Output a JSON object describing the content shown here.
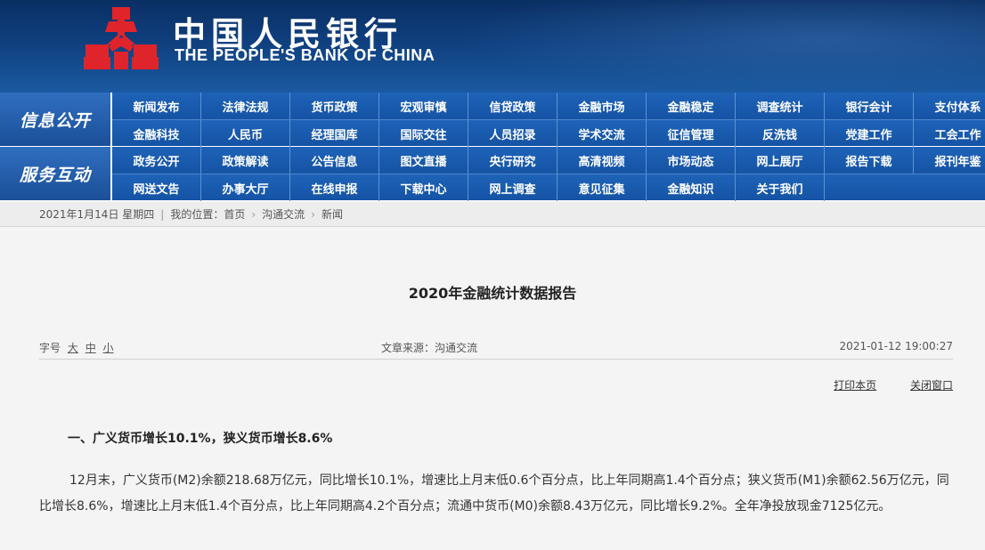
{
  "header": {
    "bank_name_cn": "中国人民银行",
    "bank_name_en": "THE PEOPLE'S BANK OF CHINA",
    "logo_icon": "pboc-logo-icon",
    "logo_color": "#e0242b"
  },
  "nav": {
    "section1_label": "信息公开",
    "section2_label": "服务互动",
    "section1_row1": [
      "新闻发布",
      "法律法规",
      "货币政策",
      "宏观审慎",
      "信贷政策",
      "金融市场",
      "金融稳定",
      "调查统计",
      "银行会计",
      "支付体系"
    ],
    "section1_row2": [
      "金融科技",
      "人民币",
      "经理国库",
      "国际交往",
      "人员招录",
      "学术交流",
      "征信管理",
      "反洗钱",
      "党建工作",
      "工会工作"
    ],
    "section2_row1": [
      "政务公开",
      "政策解读",
      "公告信息",
      "图文直播",
      "央行研究",
      "高清视频",
      "市场动态",
      "网上展厅",
      "报告下载",
      "报刊年鉴"
    ],
    "section2_row2": [
      "网送文告",
      "办事大厅",
      "在线申报",
      "下载中心",
      "网上调查",
      "意见征集",
      "金融知识",
      "关于我们"
    ]
  },
  "breadcrumb": {
    "date": "2021年1月14日 星期四",
    "position_label": "我的位置：首页",
    "level2": "沟通交流",
    "level3": "新闻"
  },
  "article": {
    "title": "2020年金融统计数据报告",
    "font_size_label": "字号",
    "size_large": "大",
    "size_medium": "中",
    "size_small": "小",
    "source": "文章来源：沟通交流",
    "datetime": "2021-01-12 19:00:27",
    "print_label": "打印本页",
    "close_label": "关闭窗口",
    "section_heading": "一、广义货币增长10.1%，狭义货币增长8.6%",
    "paragraph": "12月末，广义货币(M2)余额218.68万亿元，同比增长10.1%，增速比上月末低0.6个百分点，比上年同期高1.4个百分点；狭义货币(M1)余额62.56万亿元，同比增长8.6%，增速比上月末低1.4个百分点，比上年同期高4.2个百分点；流通中货币(M0)余额8.43万亿元，同比增长9.2%。全年净投放现金7125亿元。"
  }
}
